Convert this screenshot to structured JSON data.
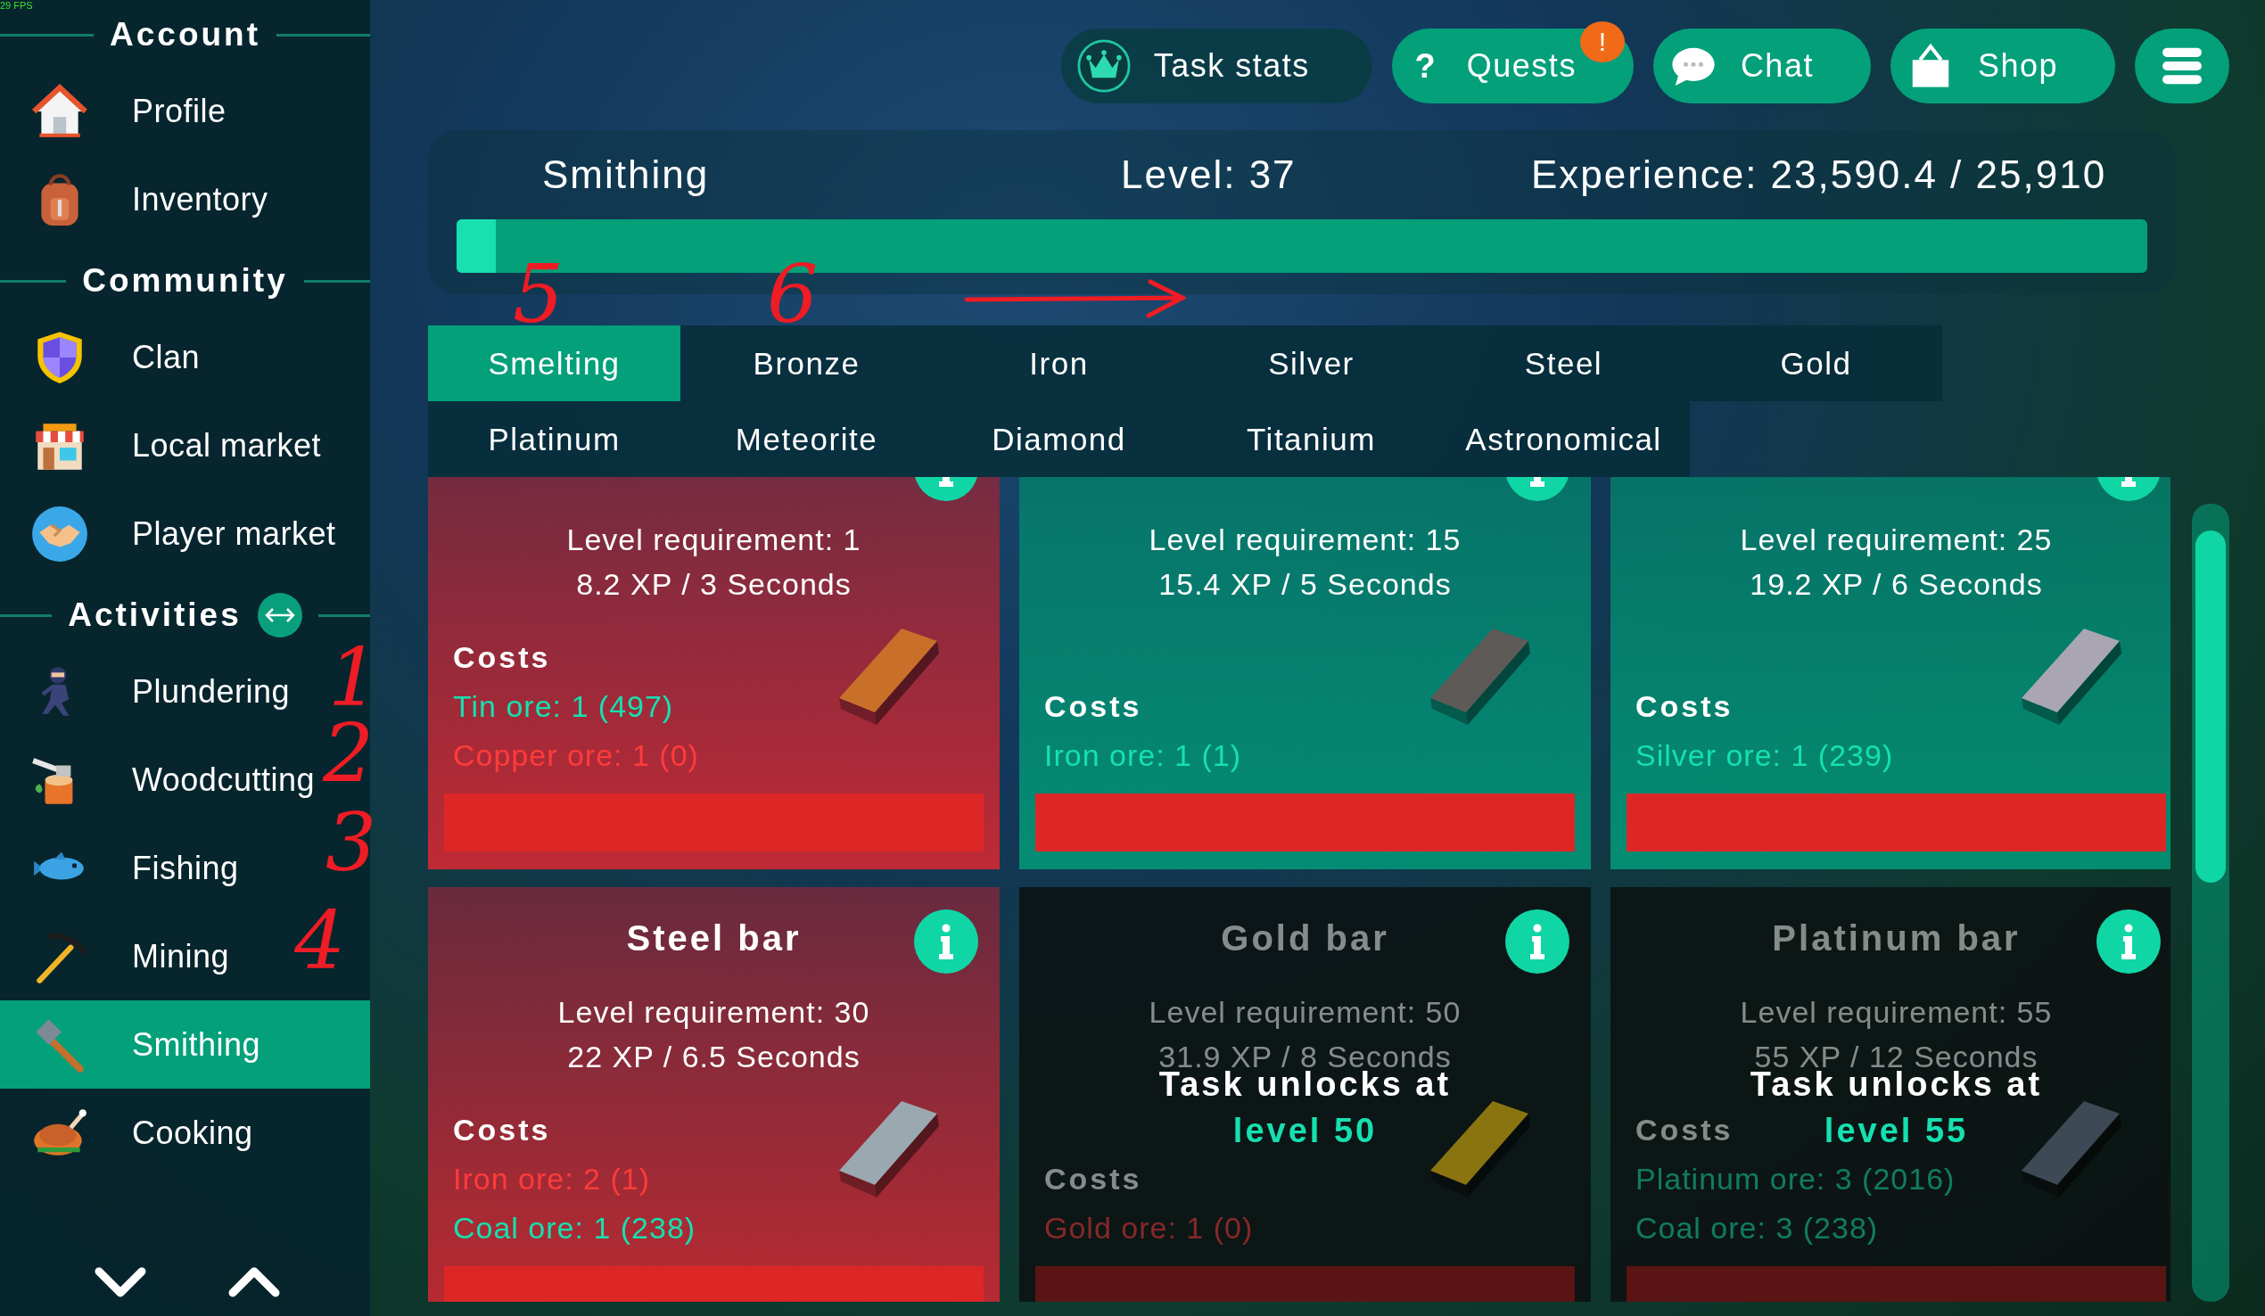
{
  "sidebar": {
    "fps": "29 FPS",
    "sections": [
      {
        "title": "Account",
        "toggle": false,
        "items": [
          {
            "label": "Profile",
            "selected": false
          },
          {
            "label": "Inventory",
            "selected": false
          }
        ]
      },
      {
        "title": "Community",
        "toggle": false,
        "items": [
          {
            "label": "Clan",
            "selected": false
          },
          {
            "label": "Local market",
            "selected": false
          },
          {
            "label": "Player market",
            "selected": false
          }
        ]
      },
      {
        "title": "Activities",
        "toggle": true,
        "items": [
          {
            "label": "Plundering",
            "selected": false
          },
          {
            "label": "Woodcutting",
            "selected": false
          },
          {
            "label": "Fishing",
            "selected": false
          },
          {
            "label": "Mining",
            "selected": false
          },
          {
            "label": "Smithing",
            "selected": true
          },
          {
            "label": "Cooking",
            "selected": false
          }
        ]
      }
    ]
  },
  "top_buttons": [
    {
      "label": "Task stats"
    },
    {
      "label": "Quests",
      "icon_text": "?",
      "badge": "!"
    },
    {
      "label": "Chat"
    },
    {
      "label": "Shop"
    }
  ],
  "skill": {
    "name": "Smithing",
    "level": "Level: 37",
    "experience": "Experience: 23,590.4 / 25,910",
    "progress": {
      "level": 0.023
    }
  },
  "tab_rows": [
    {
      "tabs": [
        {
          "label": "Smelting",
          "selected": true
        },
        {
          "label": "Bronze",
          "selected": false
        },
        {
          "label": "Iron",
          "selected": false
        },
        {
          "label": "Silver",
          "selected": false
        },
        {
          "label": "Steel",
          "selected": false
        },
        {
          "label": "Gold",
          "selected": false
        }
      ]
    },
    {
      "tabs": [
        {
          "label": "Platinum",
          "selected": false
        },
        {
          "label": "Meteorite",
          "selected": false
        },
        {
          "label": "Diamond",
          "selected": false
        },
        {
          "label": "Titanium",
          "selected": false
        },
        {
          "label": "Astronomical",
          "selected": false
        }
      ]
    }
  ],
  "cards": [
    {
      "requirement": "Level requirement: 1",
      "xp": "8.2 XP / 3 Seconds",
      "costs_label": "Costs",
      "costs": [
        {
          "text": "Tin ore: 1 (497)",
          "enough": true
        },
        {
          "text": "Copper ore: 1 (0)",
          "enough": false
        }
      ],
      "color": "#c8702a",
      "locked": false,
      "affordable": false
    },
    {
      "requirement": "Level requirement: 15",
      "xp": "15.4 XP / 5 Seconds",
      "costs_label": "Costs",
      "costs": [
        {
          "text": "Iron ore: 1 (1)",
          "enough": true
        }
      ],
      "color": "#5e5a58",
      "locked": false,
      "affordable": true
    },
    {
      "requirement": "Level requirement: 25",
      "xp": "19.2 XP / 6 Seconds",
      "costs_label": "Costs",
      "costs": [
        {
          "text": "Silver ore: 1 (239)",
          "enough": true
        }
      ],
      "color": "#a9a6b2",
      "locked": false,
      "affordable": true
    },
    {
      "title": "Steel bar",
      "requirement": "Level requirement: 30",
      "xp": "22 XP / 6.5 Seconds",
      "costs_label": "Costs",
      "costs": [
        {
          "text": "Iron ore: 2 (1)",
          "enough": false
        },
        {
          "text": "Coal ore: 1 (238)",
          "enough": true
        }
      ],
      "color": "#9aa8b0",
      "locked": false,
      "affordable": false
    },
    {
      "title": "Gold bar",
      "requirement": "Level requirement: 50",
      "xp": "31.9 XP / 8 Seconds",
      "costs_label": "Costs",
      "costs": [
        {
          "text": "Gold ore: 1 (0)",
          "enough": false
        }
      ],
      "color": "#8a7410",
      "locked": true,
      "unlock": {
        "text": "Task unlocks at",
        "level": "level 50"
      }
    },
    {
      "title": "Platinum bar",
      "requirement": "Level requirement: 55",
      "xp": "55 XP / 12 Seconds",
      "costs_label": "Costs",
      "costs": [
        {
          "text": "Platinum ore: 3 (2016)",
          "enough": true
        },
        {
          "text": "Coal ore: 3 (238)",
          "enough": true
        }
      ],
      "color": "#3d4a55",
      "locked": true,
      "unlock": {
        "text": "Task unlocks at",
        "level": "level 55"
      }
    }
  ],
  "annotations": [
    {
      "kind": "digit",
      "text": "1"
    },
    {
      "kind": "digit",
      "text": "2"
    },
    {
      "kind": "digit",
      "text": "3"
    },
    {
      "kind": "digit",
      "text": "4"
    },
    {
      "kind": "digit",
      "text": "5"
    },
    {
      "kind": "digit",
      "text": "6"
    },
    {
      "kind": "arrow"
    }
  ]
}
